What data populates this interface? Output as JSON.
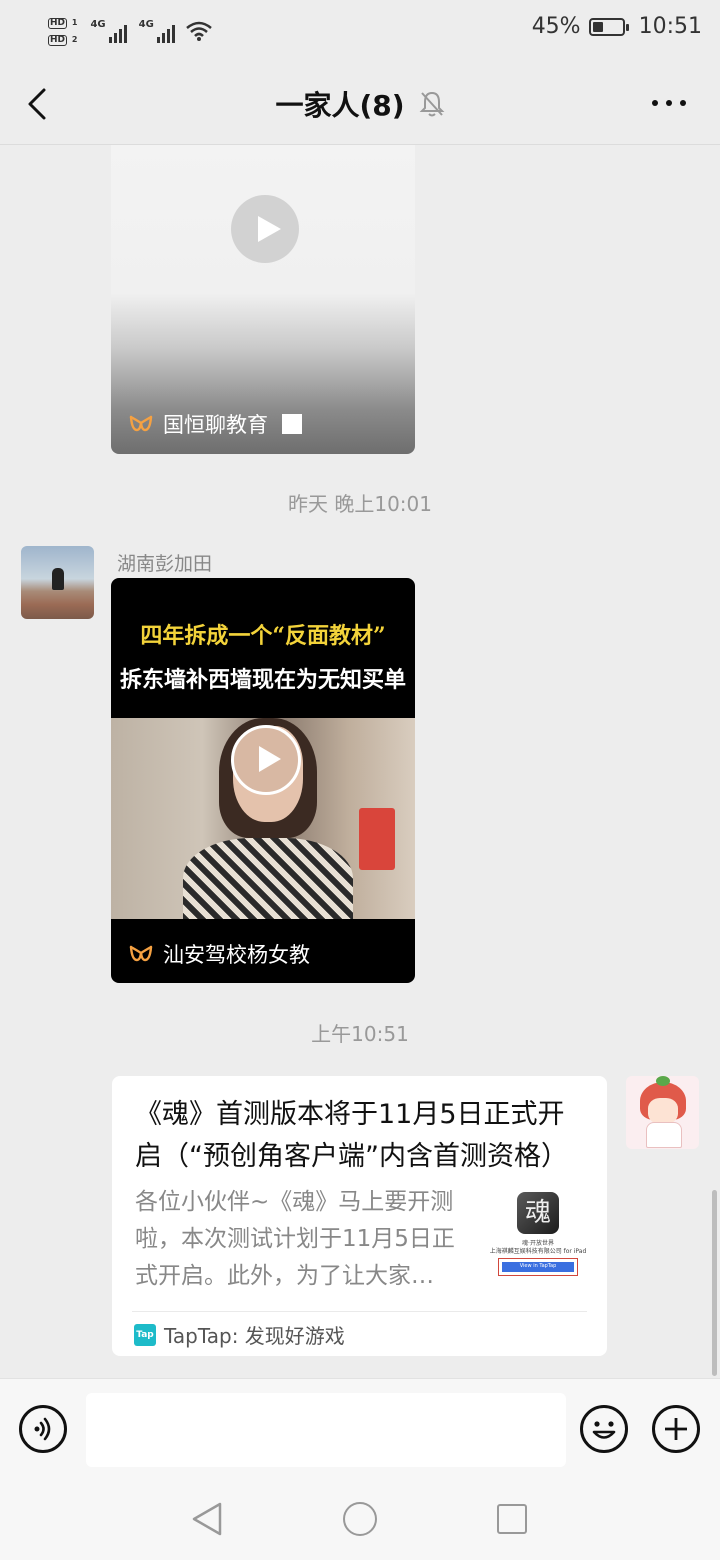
{
  "status_bar": {
    "hd1": "HD",
    "hd1_sub": "1",
    "hd2": "HD",
    "hd2_sub": "2",
    "net1": "4G",
    "net2": "4G",
    "battery_percent": "45%",
    "battery_level": 0.45,
    "time": "10:51"
  },
  "header": {
    "title": "一家人(8)",
    "icons": [
      "back-icon",
      "mute-bell-icon",
      "more-icon"
    ]
  },
  "messages": [
    {
      "type": "video",
      "channel": "国恒聊教育",
      "icon": "play-icon"
    },
    {
      "type": "timestamp",
      "text": "昨天 晚上10:01"
    },
    {
      "type": "video",
      "sender": "湖南彭加田",
      "caption_line1": "四年拆成一个“反面教材”",
      "caption_line2": "拆东墙补西墙现在为无知买单",
      "channel": "汕安驾校杨女教",
      "icon": "play-icon"
    },
    {
      "type": "timestamp",
      "text": "上午10:51"
    },
    {
      "type": "link",
      "title": "《魂》首测版本将于11月5日正式开启（“预创角客户端”内含首测资格）",
      "description": "各位小伙伴~《魂》马上要开测啦，本次测试计划于11月5日正式开启。此外，为了让大家…",
      "thumb_icon_text": "魂",
      "thumb_line1": "魂·开放世界",
      "thumb_line2": "上海褀麟互娱科技有限公司 for iPad",
      "thumb_button": "View in TapTap",
      "source_icon": "Tap",
      "source": "TapTap: 发现好游戏"
    }
  ],
  "input_bar": {
    "value": "",
    "icons": [
      "voice-icon",
      "emoji-icon",
      "plus-icon"
    ]
  },
  "colors": {
    "background": "#ededed",
    "taptap": "#1dbbc9",
    "channel_logo": "#f5a142"
  }
}
